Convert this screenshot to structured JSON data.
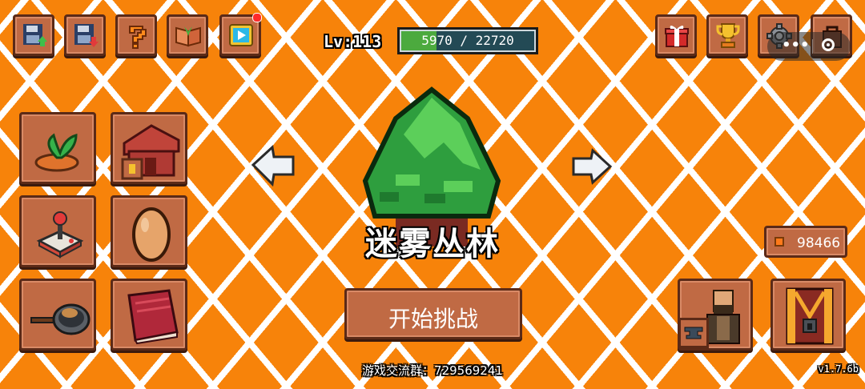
{
  "header": {
    "level_label": "Lv:113",
    "xp_text": "5970 / 22720",
    "xp_fraction": 0.263
  },
  "top_left_buttons": [
    {
      "name": "save-upload-button",
      "icon": "floppy-upload-icon"
    },
    {
      "name": "save-download-button",
      "icon": "floppy-download-icon"
    },
    {
      "name": "help-button",
      "icon": "question-mark-icon"
    },
    {
      "name": "codex-button",
      "icon": "open-book-icon"
    },
    {
      "name": "video-button",
      "icon": "play-screen-icon",
      "badge": true
    }
  ],
  "top_right_buttons": [
    {
      "name": "gift-button",
      "icon": "gift-box-icon"
    },
    {
      "name": "trophy-button",
      "icon": "trophy-icon"
    },
    {
      "name": "settings-button",
      "icon": "gear-icon"
    },
    {
      "name": "shop-button",
      "icon": "bag-icon"
    }
  ],
  "stage": {
    "name": "迷雾丛林",
    "start_label": "开始挑战",
    "prev_icon": "arrow-left-icon",
    "next_icon": "arrow-right-icon"
  },
  "currency": {
    "value": "98466",
    "icon": "coin-icon"
  },
  "footer": {
    "group_text": "游戏交流群：729569241",
    "version": "v1.7.6b"
  },
  "left_grid": [
    {
      "name": "farm-button",
      "icon": "sprout-icon"
    },
    {
      "name": "house-button",
      "icon": "house-icon"
    },
    {
      "name": "arcade-button",
      "icon": "joystick-icon"
    },
    {
      "name": "egg-button",
      "icon": "egg-icon"
    },
    {
      "name": "cooking-button",
      "icon": "frying-pan-icon"
    },
    {
      "name": "book-button",
      "icon": "red-book-icon"
    }
  ],
  "right_buttons": [
    {
      "name": "blacksmith-button",
      "icon": "blacksmith-icon"
    },
    {
      "name": "chest-button",
      "icon": "treasure-chest-icon"
    }
  ],
  "colors": {
    "background": "#f7830a",
    "button": "#c06a44",
    "button_border": "#5b2a17",
    "xp_fill": "#4caa3e",
    "xp_bg": "#234a55"
  }
}
